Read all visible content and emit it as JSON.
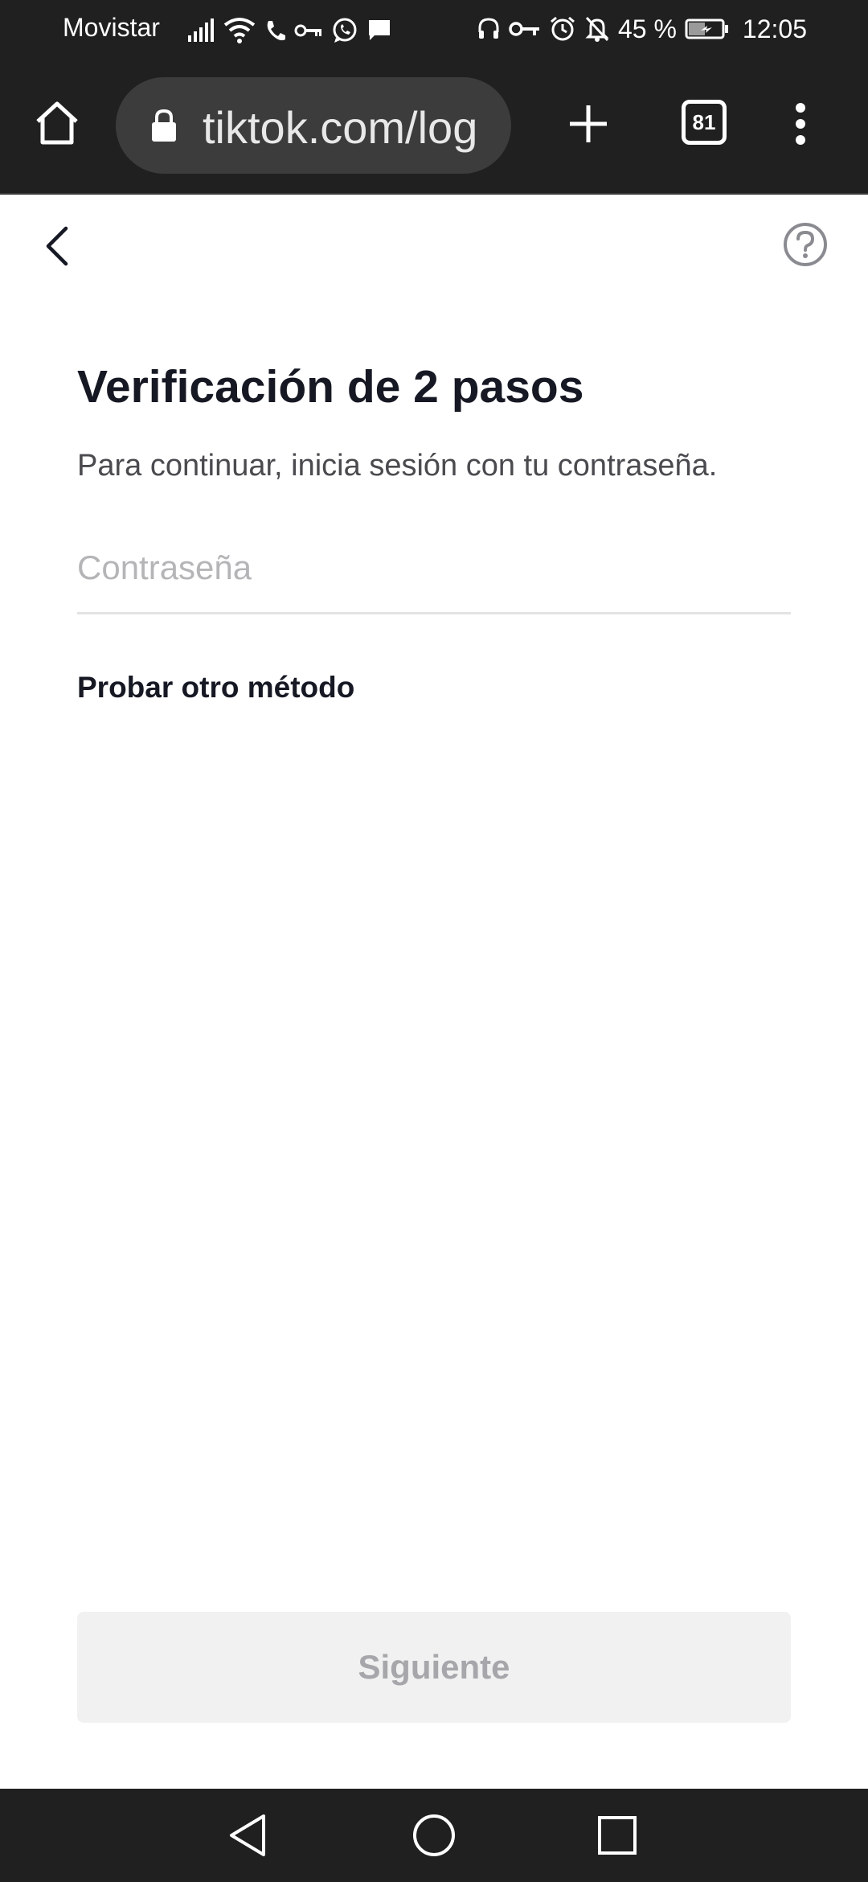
{
  "status_bar": {
    "carrier": "Movistar",
    "battery_percent": "45 %",
    "time": "12:05",
    "left_icons": [
      "signal-icon",
      "wifi-icon",
      "call-icon",
      "key-icon",
      "whatsapp-icon",
      "message-icon"
    ],
    "right_icons": [
      "headset-icon",
      "vpn-key-icon",
      "alarm-icon",
      "bell-off-icon",
      "battery-icon"
    ]
  },
  "browser": {
    "url": "tiktok.com/log",
    "tab_count": "81"
  },
  "page": {
    "title": "Verificación de 2 pasos",
    "subtitle": "Para continuar, inicia sesión con tu contraseña.",
    "password_placeholder": "Contraseña",
    "password_value": "",
    "alt_method_label": "Probar otro método",
    "next_button_label": "Siguiente"
  },
  "colors": {
    "system_bar_bg": "#202020",
    "url_pill_bg": "#3c3c3c",
    "title_text": "#161823",
    "placeholder_text": "#b5b5b8",
    "disabled_button_bg": "#f1f1f2",
    "disabled_button_text": "#a7a7ab"
  }
}
